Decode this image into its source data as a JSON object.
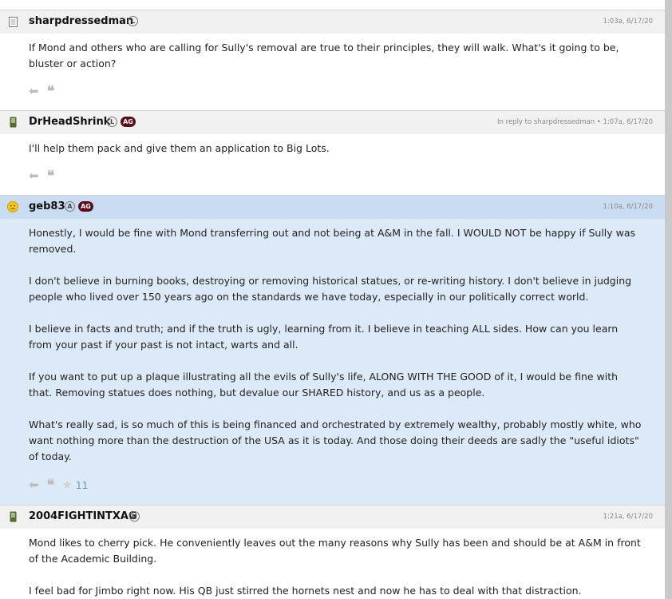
{
  "posts": [
    {
      "username": "sharpdressedman",
      "badges": [
        "L"
      ],
      "meta": "1:03a, 6/17/20",
      "paragraphs": [
        "If Mond and others who are calling for Sully's removal are true to their principles, they will walk. What's it going to be, bluster or action?"
      ]
    },
    {
      "username": "DrHeadShrink",
      "badges": [
        "L",
        "AG"
      ],
      "meta": "In reply to sharpdressedman • 1:07a, 6/17/20",
      "paragraphs": [
        "I'll help them pack and give them an application to Big Lots."
      ]
    },
    {
      "username": "geb83",
      "badges": [
        "A",
        "AG"
      ],
      "meta": "1:10a, 6/17/20",
      "star_count": "11",
      "paragraphs": [
        "Honestly, I would be fine with Mond transferring out and not being at A&M in the fall. I WOULD NOT be happy if Sully was removed.",
        "I don't believe in burning books, destroying or removing historical statues, or re-writing history. I don't believe in judging people who lived over 150 years ago on the standards we have today, especially in our politically correct world.",
        "I believe in facts and truth; and if the truth is ugly, learning from it. I believe in teaching ALL sides. How can you learn from your past if your past is not intact, warts and all.",
        "If you want to put up a plaque illustrating all the evils of Sully's life, ALONG WITH THE GOOD of it, I would be fine with that. Removing statues does nothing, but devalue our SHARED history, and us as a people.",
        "What's really sad, is so much of this is being financed and orchestrated by extremely wealthy, probably mostly white, who want nothing more than the destruction of the USA as it is today. And those doing their deeds are sadly the \"useful idiots\" of today."
      ]
    },
    {
      "username": "2004FIGHTINTXAG",
      "badges": [
        "H"
      ],
      "meta": "1:21a, 6/17/20",
      "paragraphs": [
        "Mond likes to cherry pick. He conveniently leaves out the many reasons why Sully has been and should be at A&M in front of the Academic Building.",
        "I feel bad for Jimbo right now. His QB just stirred the hornets nest and now he has to deal with that distraction."
      ]
    }
  ],
  "actions": {
    "reply_glyph": "⬅",
    "quote_glyph": "❝"
  },
  "colors": {
    "header_bg": "#f1f1f1",
    "highlight_header_bg": "#c9dcf2",
    "highlight_body_bg": "#dceaf8",
    "ag_badge": "#5c0a16",
    "star_count": "#6d99c9"
  },
  "icons": {
    "post1": "document-icon",
    "post2": "phone-icon",
    "post3": "frown-emoji-icon",
    "post4": "phone-icon"
  }
}
